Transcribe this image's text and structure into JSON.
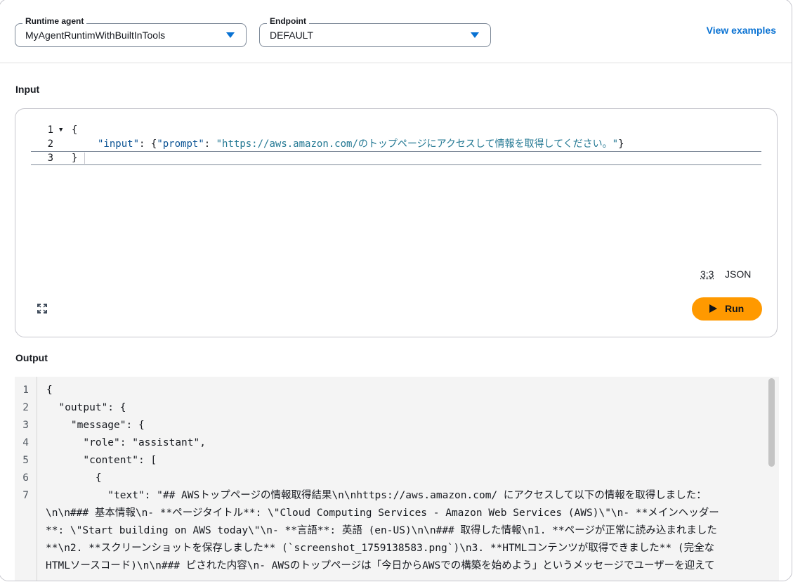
{
  "agent_select": {
    "legend": "Runtime agent",
    "value": "MyAgentRuntimWithBuiltInTools"
  },
  "endpoint_select": {
    "legend": "Endpoint",
    "value": "DEFAULT"
  },
  "view_examples": "View examples",
  "input_section": {
    "label": "Input",
    "line_numbers": [
      "1",
      "2",
      "3"
    ],
    "line1": "{",
    "line2_key1": "\"input\"",
    "line2_sep1": ": {",
    "line2_key2": "\"prompt\"",
    "line2_sep2": ": ",
    "line2_value": "\"https://aws.amazon.com/のトップページにアクセスして情報を取得してください。\"",
    "line2_close": "}",
    "line3": "}",
    "cursor_position": "3:3",
    "language": "JSON",
    "run_label": "Run"
  },
  "output_section": {
    "label": "Output",
    "line_numbers": [
      "1",
      "2",
      "3",
      "4",
      "5",
      "6",
      "7"
    ],
    "lines": [
      "{",
      "  \"output\": {",
      "    \"message\": {",
      "      \"role\": \"assistant\",",
      "      \"content\": [",
      "        {",
      "          \"text\": \"## AWSトップページの情報取得結果\\n\\nhttps://aws.amazon.com/ にアクセスして以下の情報を取得しました：",
      "\\n\\n### 基本情報\\n- **ページタイトル**: \\\"Cloud Computing Services - Amazon Web Services (AWS)\\\"\\n- **メインヘッダー",
      "**: \\\"Start building on AWS today\\\"\\n- **言語**: 英語 (en-US)\\n\\n### 取得した情報\\n1. **ページが正常に読み込まれました",
      "**\\n2. **スクリーンショットを保存しました** (`screenshot_1759138583.png`)\\n3. **HTMLコンテンツが取得できました** (完全な",
      "HTMLソースコード)\\n\\n### ピされた内容\\n- AWSのトップページは「今日からAWSでの構築を始めよう」というメッセージでユーザーを迎えて"
    ]
  }
}
